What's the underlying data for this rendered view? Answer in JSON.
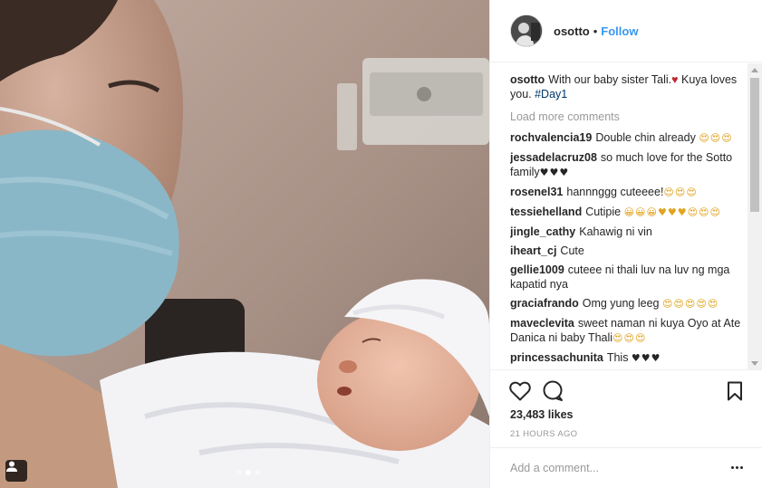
{
  "post": {
    "username": "osotto",
    "separator": "•",
    "follow_label": "Follow",
    "caption": {
      "user": "osotto",
      "text_before": "With our baby sister Tali.",
      "text_after": " Kuya loves you. ",
      "hashtag": "#Day1"
    },
    "load_more_label": "Load more comments",
    "comments": [
      {
        "user": "rochvalencia19",
        "text": "Double chin already ",
        "emoji": "😍😍😍",
        "emoji_style": "gold"
      },
      {
        "user": "jessadelacruz08",
        "text": "so much love for the Sotto family",
        "emoji": "♥♥♥",
        "emoji_style": "dark"
      },
      {
        "user": "rosenel31",
        "text": "hannnggg cuteeee!",
        "emoji": "😍😍😍",
        "emoji_style": "gold"
      },
      {
        "user": "tessiehelland",
        "text": "Cutipie ",
        "emoji": "😀😀😀♥♥♥😍😍😍",
        "emoji_style": "gold"
      },
      {
        "user": "jingle_cathy",
        "text": "Kahawig ni vin",
        "emoji": "",
        "emoji_style": "gold"
      },
      {
        "user": "iheart_cj",
        "text": "Cute",
        "emoji": "",
        "emoji_style": "gold"
      },
      {
        "user": "gellie1009",
        "text": "cuteee ni thali luv na luv ng mga kapatid nya",
        "emoji": "",
        "emoji_style": "gold"
      },
      {
        "user": "graciafrando",
        "text": "Omg yung leeg ",
        "emoji": "😍😍😍😍😍",
        "emoji_style": "gold"
      },
      {
        "user": "maveclevita",
        "text": "sweet naman ni kuya Oyo at Ate Danica ni baby Thali",
        "emoji": "😍😍😍",
        "emoji_style": "gold"
      },
      {
        "user": "princessachunita",
        "text": "This ",
        "emoji": "♥♥♥",
        "emoji_style": "dark"
      }
    ],
    "likes": "23,483 likes",
    "time": "21 HOURS AGO",
    "add_comment_placeholder": "Add a comment..."
  },
  "colors": {
    "link_blue": "#3897f0",
    "heart_red": "#c0262d",
    "muted_gray": "#999999",
    "border": "#efefef"
  },
  "icons": {
    "like": "heart-outline-icon",
    "comment": "speech-bubble-icon",
    "save": "bookmark-icon",
    "more": "more-horizontal-icon",
    "tagged": "person-tag-icon"
  }
}
